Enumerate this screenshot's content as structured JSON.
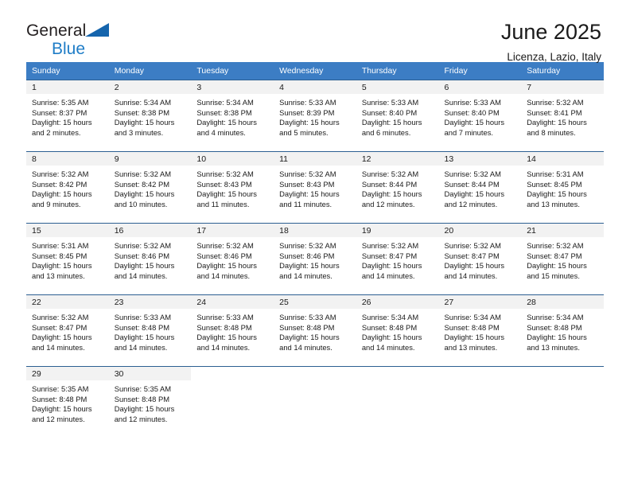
{
  "brand": {
    "name_part1": "General",
    "name_part2": "Blue",
    "flag_icon": "triangle-flag-icon",
    "accent_color": "#1f7dc7"
  },
  "header": {
    "month_title": "June 2025",
    "location": "Licenza, Lazio, Italy"
  },
  "theme": {
    "header_row_bg": "#3c7dc4",
    "row_border": "#2c5f92",
    "daynum_band_bg": "#f2f2f2",
    "text_color": "#1a1a1a"
  },
  "weekday_headers": [
    "Sunday",
    "Monday",
    "Tuesday",
    "Wednesday",
    "Thursday",
    "Friday",
    "Saturday"
  ],
  "weeks": [
    [
      {
        "day": "1",
        "sunrise": "Sunrise: 5:35 AM",
        "sunset": "Sunset: 8:37 PM",
        "daylight1": "Daylight: 15 hours",
        "daylight2": "and 2 minutes."
      },
      {
        "day": "2",
        "sunrise": "Sunrise: 5:34 AM",
        "sunset": "Sunset: 8:38 PM",
        "daylight1": "Daylight: 15 hours",
        "daylight2": "and 3 minutes."
      },
      {
        "day": "3",
        "sunrise": "Sunrise: 5:34 AM",
        "sunset": "Sunset: 8:38 PM",
        "daylight1": "Daylight: 15 hours",
        "daylight2": "and 4 minutes."
      },
      {
        "day": "4",
        "sunrise": "Sunrise: 5:33 AM",
        "sunset": "Sunset: 8:39 PM",
        "daylight1": "Daylight: 15 hours",
        "daylight2": "and 5 minutes."
      },
      {
        "day": "5",
        "sunrise": "Sunrise: 5:33 AM",
        "sunset": "Sunset: 8:40 PM",
        "daylight1": "Daylight: 15 hours",
        "daylight2": "and 6 minutes."
      },
      {
        "day": "6",
        "sunrise": "Sunrise: 5:33 AM",
        "sunset": "Sunset: 8:40 PM",
        "daylight1": "Daylight: 15 hours",
        "daylight2": "and 7 minutes."
      },
      {
        "day": "7",
        "sunrise": "Sunrise: 5:32 AM",
        "sunset": "Sunset: 8:41 PM",
        "daylight1": "Daylight: 15 hours",
        "daylight2": "and 8 minutes."
      }
    ],
    [
      {
        "day": "8",
        "sunrise": "Sunrise: 5:32 AM",
        "sunset": "Sunset: 8:42 PM",
        "daylight1": "Daylight: 15 hours",
        "daylight2": "and 9 minutes."
      },
      {
        "day": "9",
        "sunrise": "Sunrise: 5:32 AM",
        "sunset": "Sunset: 8:42 PM",
        "daylight1": "Daylight: 15 hours",
        "daylight2": "and 10 minutes."
      },
      {
        "day": "10",
        "sunrise": "Sunrise: 5:32 AM",
        "sunset": "Sunset: 8:43 PM",
        "daylight1": "Daylight: 15 hours",
        "daylight2": "and 11 minutes."
      },
      {
        "day": "11",
        "sunrise": "Sunrise: 5:32 AM",
        "sunset": "Sunset: 8:43 PM",
        "daylight1": "Daylight: 15 hours",
        "daylight2": "and 11 minutes."
      },
      {
        "day": "12",
        "sunrise": "Sunrise: 5:32 AM",
        "sunset": "Sunset: 8:44 PM",
        "daylight1": "Daylight: 15 hours",
        "daylight2": "and 12 minutes."
      },
      {
        "day": "13",
        "sunrise": "Sunrise: 5:32 AM",
        "sunset": "Sunset: 8:44 PM",
        "daylight1": "Daylight: 15 hours",
        "daylight2": "and 12 minutes."
      },
      {
        "day": "14",
        "sunrise": "Sunrise: 5:31 AM",
        "sunset": "Sunset: 8:45 PM",
        "daylight1": "Daylight: 15 hours",
        "daylight2": "and 13 minutes."
      }
    ],
    [
      {
        "day": "15",
        "sunrise": "Sunrise: 5:31 AM",
        "sunset": "Sunset: 8:45 PM",
        "daylight1": "Daylight: 15 hours",
        "daylight2": "and 13 minutes."
      },
      {
        "day": "16",
        "sunrise": "Sunrise: 5:32 AM",
        "sunset": "Sunset: 8:46 PM",
        "daylight1": "Daylight: 15 hours",
        "daylight2": "and 14 minutes."
      },
      {
        "day": "17",
        "sunrise": "Sunrise: 5:32 AM",
        "sunset": "Sunset: 8:46 PM",
        "daylight1": "Daylight: 15 hours",
        "daylight2": "and 14 minutes."
      },
      {
        "day": "18",
        "sunrise": "Sunrise: 5:32 AM",
        "sunset": "Sunset: 8:46 PM",
        "daylight1": "Daylight: 15 hours",
        "daylight2": "and 14 minutes."
      },
      {
        "day": "19",
        "sunrise": "Sunrise: 5:32 AM",
        "sunset": "Sunset: 8:47 PM",
        "daylight1": "Daylight: 15 hours",
        "daylight2": "and 14 minutes."
      },
      {
        "day": "20",
        "sunrise": "Sunrise: 5:32 AM",
        "sunset": "Sunset: 8:47 PM",
        "daylight1": "Daylight: 15 hours",
        "daylight2": "and 14 minutes."
      },
      {
        "day": "21",
        "sunrise": "Sunrise: 5:32 AM",
        "sunset": "Sunset: 8:47 PM",
        "daylight1": "Daylight: 15 hours",
        "daylight2": "and 15 minutes."
      }
    ],
    [
      {
        "day": "22",
        "sunrise": "Sunrise: 5:32 AM",
        "sunset": "Sunset: 8:47 PM",
        "daylight1": "Daylight: 15 hours",
        "daylight2": "and 14 minutes."
      },
      {
        "day": "23",
        "sunrise": "Sunrise: 5:33 AM",
        "sunset": "Sunset: 8:48 PM",
        "daylight1": "Daylight: 15 hours",
        "daylight2": "and 14 minutes."
      },
      {
        "day": "24",
        "sunrise": "Sunrise: 5:33 AM",
        "sunset": "Sunset: 8:48 PM",
        "daylight1": "Daylight: 15 hours",
        "daylight2": "and 14 minutes."
      },
      {
        "day": "25",
        "sunrise": "Sunrise: 5:33 AM",
        "sunset": "Sunset: 8:48 PM",
        "daylight1": "Daylight: 15 hours",
        "daylight2": "and 14 minutes."
      },
      {
        "day": "26",
        "sunrise": "Sunrise: 5:34 AM",
        "sunset": "Sunset: 8:48 PM",
        "daylight1": "Daylight: 15 hours",
        "daylight2": "and 14 minutes."
      },
      {
        "day": "27",
        "sunrise": "Sunrise: 5:34 AM",
        "sunset": "Sunset: 8:48 PM",
        "daylight1": "Daylight: 15 hours",
        "daylight2": "and 13 minutes."
      },
      {
        "day": "28",
        "sunrise": "Sunrise: 5:34 AM",
        "sunset": "Sunset: 8:48 PM",
        "daylight1": "Daylight: 15 hours",
        "daylight2": "and 13 minutes."
      }
    ],
    [
      {
        "day": "29",
        "sunrise": "Sunrise: 5:35 AM",
        "sunset": "Sunset: 8:48 PM",
        "daylight1": "Daylight: 15 hours",
        "daylight2": "and 12 minutes."
      },
      {
        "day": "30",
        "sunrise": "Sunrise: 5:35 AM",
        "sunset": "Sunset: 8:48 PM",
        "daylight1": "Daylight: 15 hours",
        "daylight2": "and 12 minutes."
      },
      {
        "day": "",
        "empty": true
      },
      {
        "day": "",
        "empty": true
      },
      {
        "day": "",
        "empty": true
      },
      {
        "day": "",
        "empty": true
      },
      {
        "day": "",
        "empty": true
      }
    ]
  ]
}
